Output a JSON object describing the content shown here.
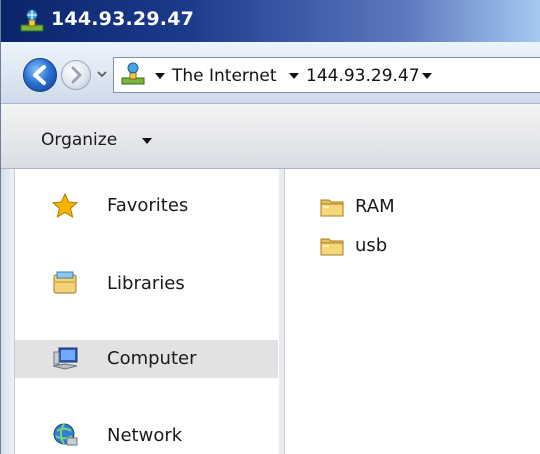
{
  "window": {
    "title": "144.93.29.47"
  },
  "address_bar": {
    "crumbs": [
      {
        "label": "The Internet"
      },
      {
        "label": "144.93.29.47"
      }
    ]
  },
  "command_bar": {
    "organize_label": "Organize"
  },
  "nav_pane": {
    "items": [
      {
        "label": "Favorites",
        "icon": "star-icon",
        "selected": false
      },
      {
        "label": "Libraries",
        "icon": "libraries-icon",
        "selected": false
      },
      {
        "label": "Computer",
        "icon": "computer-icon",
        "selected": true
      },
      {
        "label": "Network",
        "icon": "network-icon",
        "selected": false
      }
    ]
  },
  "content": {
    "items": [
      {
        "label": "RAM",
        "icon": "folder-icon"
      },
      {
        "label": "usb",
        "icon": "folder-icon"
      }
    ]
  },
  "colors": {
    "titlebar_dark": "#0a246a",
    "titlebar_light": "#a6caf0",
    "selected_item": "#e2e2e2"
  }
}
